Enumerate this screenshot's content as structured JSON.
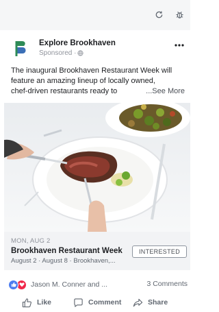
{
  "toolbar": {
    "refresh_icon": "refresh-icon",
    "bug_icon": "bug-icon"
  },
  "post": {
    "page_name": "Explore Brookhaven",
    "meta": "Sponsored ·",
    "text_lines": [
      "The inaugural Brookhaven Restaurant Week will",
      "feature an amazing lineup of locally owned,",
      "chef-driven restaurants ready to"
    ],
    "see_more": "...See More"
  },
  "event": {
    "date": "MON, AUG 2",
    "title": "Brookhaven Restaurant Week",
    "subtitle": "August 2 · August 8 · Brookhaven,...",
    "interested_label": "INTERESTED"
  },
  "stats": {
    "reactors": "Jason M. Conner and ...",
    "comments": "3 Comments"
  },
  "actions": {
    "like": "Like",
    "comment": "Comment",
    "share": "Share"
  },
  "colors": {
    "brand_blue": "#4c7df0",
    "love_red": "#f0284a",
    "logo_green": "#2e8b57",
    "logo_blue": "#3b6fb6"
  }
}
